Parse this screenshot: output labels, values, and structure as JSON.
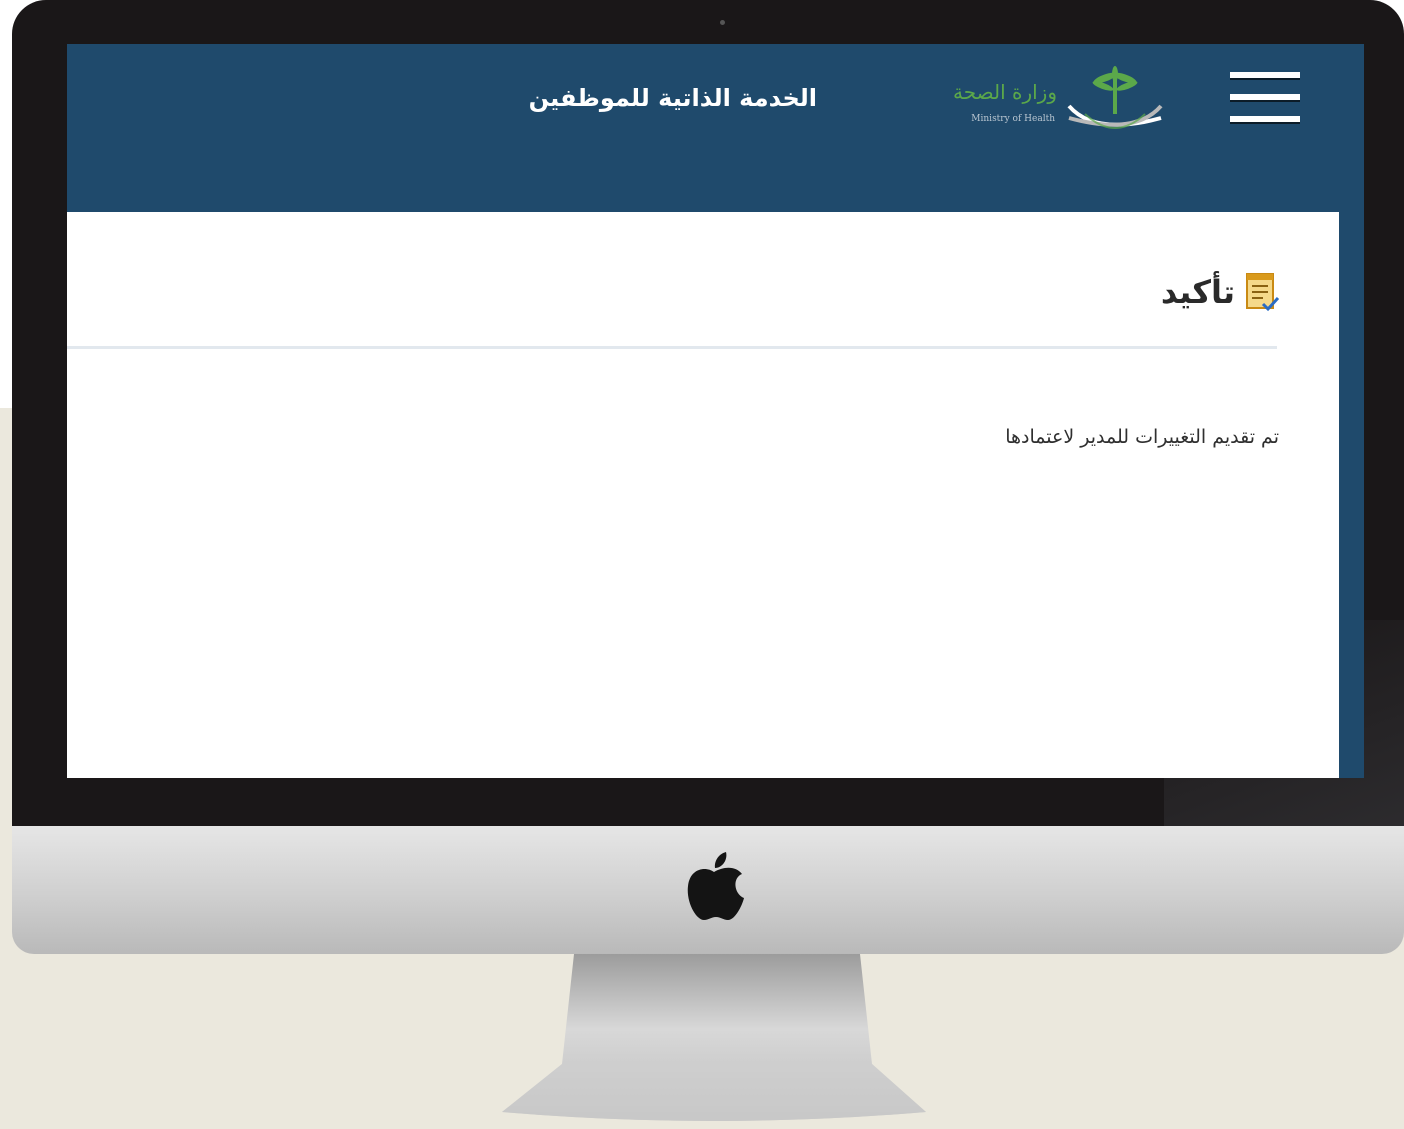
{
  "header": {
    "app_title": "الخدمة الذاتية للموظفين",
    "logo": {
      "text_ar": "وزارة الصحة",
      "text_en": "Ministry of Health",
      "icon": "palm-and-swords-emblem"
    },
    "menu_icon": "hamburger-menu-icon"
  },
  "page": {
    "title": "تأكيد",
    "title_icon": "document-check-icon",
    "message": "تم تقديم التغييرات للمدير لاعتمادها"
  },
  "colors": {
    "header_bg": "#1f4a6c",
    "content_bg": "#ffffff",
    "logo_green": "#5ba84a",
    "backdrop": "#ebe8dd"
  },
  "device": {
    "brand_icon": "apple-logo-icon"
  }
}
